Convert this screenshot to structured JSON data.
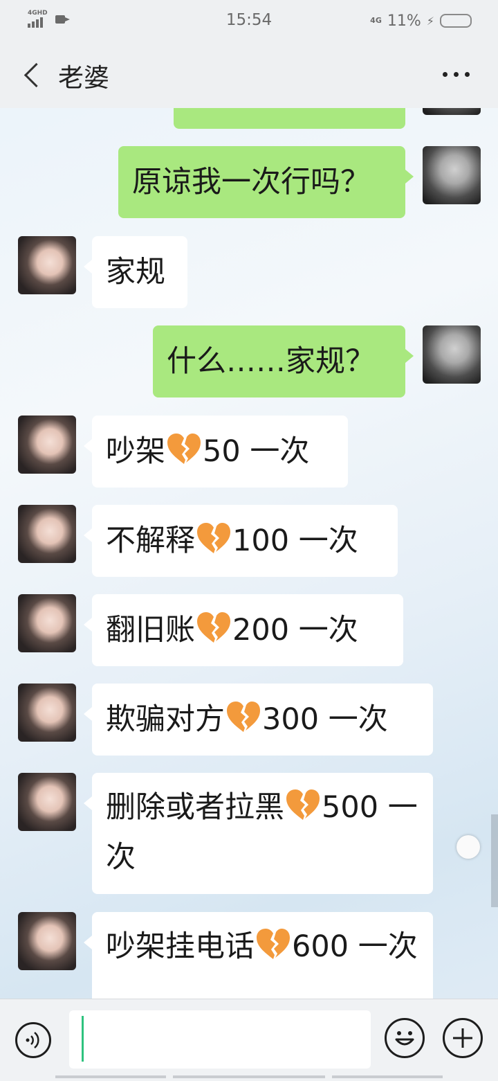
{
  "status_bar": {
    "left_network": "4GHD",
    "time": "15:54",
    "network": "4G",
    "battery_percent": "11%",
    "icons": [
      "signal-icon",
      "video-call-icon",
      "charging-bolt-icon",
      "battery-icon"
    ]
  },
  "header": {
    "title": "老婆",
    "back_icon": "chevron-left-icon",
    "more_icon": "more-dots-icon"
  },
  "messages": [
    {
      "sender": "me",
      "text": "原谅我一次行吗？"
    },
    {
      "sender": "wife",
      "text": "家规"
    },
    {
      "sender": "me",
      "text": "什么……家规？"
    },
    {
      "sender": "wife",
      "before": "吵架",
      "after": "50 一次",
      "icon": "broken-heart-icon"
    },
    {
      "sender": "wife",
      "before": "不解释",
      "after": "100 一次",
      "icon": "broken-heart-icon"
    },
    {
      "sender": "wife",
      "before": "翻旧账",
      "after": "200 一次",
      "icon": "broken-heart-icon"
    },
    {
      "sender": "wife",
      "before": "欺骗对方",
      "after": "300 一次",
      "icon": "broken-heart-icon"
    },
    {
      "sender": "wife",
      "before": "删除或者拉黑",
      "after": "500 一次",
      "icon": "broken-heart-icon"
    },
    {
      "sender": "wife",
      "before": "吵架挂电话",
      "after": "600 一次",
      "icon": "broken-heart-icon"
    }
  ],
  "input_bar": {
    "text_value": "",
    "icons": [
      "voice-icon",
      "emoji-icon",
      "plus-icon"
    ]
  },
  "colors": {
    "my_bubble": "#a9e87f",
    "their_bubble": "#ffffff",
    "bar_background": "#eef0f2",
    "cursor": "#2ec27e"
  }
}
